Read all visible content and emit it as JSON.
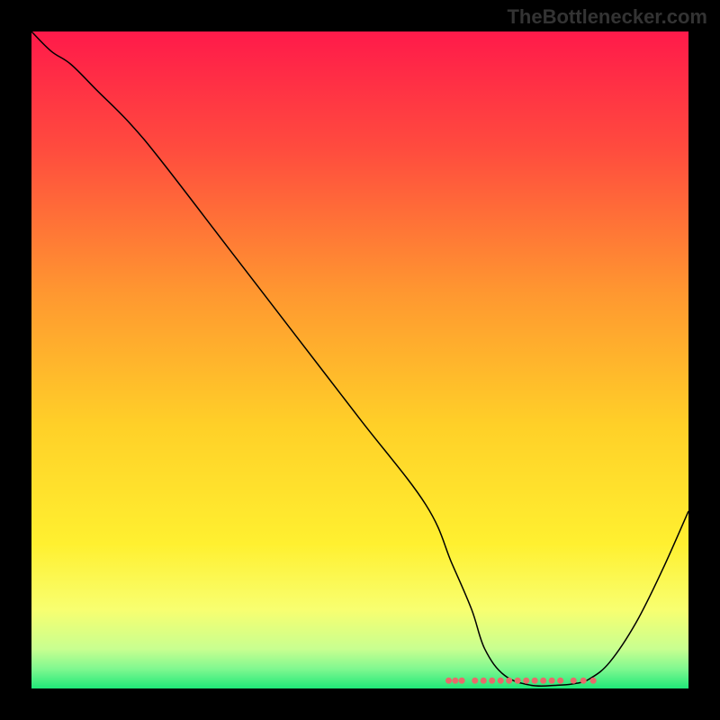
{
  "watermark": "TheBottlenecker.com",
  "chart_data": {
    "type": "line",
    "title": "",
    "xlabel": "",
    "ylabel": "",
    "xlim": [
      0,
      100
    ],
    "ylim": [
      0,
      100
    ],
    "grid": false,
    "background_gradient": {
      "stops": [
        {
          "offset": 0,
          "color": "#ff1a4a"
        },
        {
          "offset": 18,
          "color": "#ff4c3e"
        },
        {
          "offset": 40,
          "color": "#ff9830"
        },
        {
          "offset": 60,
          "color": "#ffd028"
        },
        {
          "offset": 78,
          "color": "#fff030"
        },
        {
          "offset": 88,
          "color": "#f8ff70"
        },
        {
          "offset": 94,
          "color": "#c8ff90"
        },
        {
          "offset": 97,
          "color": "#80f890"
        },
        {
          "offset": 100,
          "color": "#20e878"
        }
      ]
    },
    "series": [
      {
        "name": "curve",
        "color": "#000000",
        "stroke_width": 1.5,
        "x": [
          0,
          3,
          6,
          10,
          15,
          20,
          30,
          40,
          50,
          60,
          64,
          67,
          69,
          72,
          76,
          80,
          83,
          85,
          88,
          92,
          96,
          100
        ],
        "y": [
          100,
          97,
          95,
          91,
          86,
          80,
          67,
          54,
          41,
          28,
          19,
          12,
          6,
          2,
          0.5,
          0.5,
          0.8,
          1.5,
          4,
          10,
          18,
          27
        ]
      }
    ],
    "marker_band": {
      "name": "optimal-range",
      "color": "#e86a6a",
      "y": 1.2,
      "segments": [
        {
          "x": [
            63.5,
            65.5
          ]
        },
        {
          "x": [
            67.5,
            80.5
          ]
        },
        {
          "x": [
            82.5,
            85.5
          ]
        }
      ],
      "dot_radius": 3.5
    }
  }
}
